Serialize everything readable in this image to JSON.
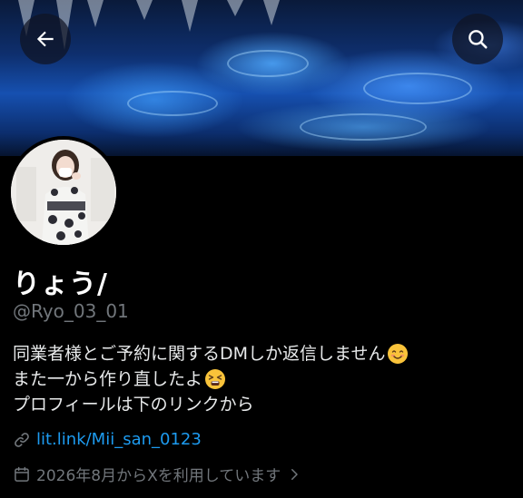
{
  "header": {
    "back_icon": "arrow-left-icon",
    "search_icon": "search-icon"
  },
  "profile": {
    "display_name": "りょう/",
    "handle": "@Ryo_03_01",
    "bio_lines": [
      "同業者様とご予約に関するDMしか返信しません",
      "また一から作り直したよ",
      "プロフィールは下のリンクから"
    ],
    "bio_emojis": [
      "smiling-face-emoji",
      "tired-face-emoji"
    ],
    "link": "lit.link/Mii_san_0123",
    "link_icon": "link-icon",
    "joined": "2026年8月からXを利用しています",
    "joined_icon": "calendar-icon",
    "joined_chevron_icon": "chevron-right-icon"
  },
  "colors": {
    "background": "#000000",
    "text": "#e7e9ea",
    "muted": "#71767b",
    "link": "#1d9bf0"
  }
}
